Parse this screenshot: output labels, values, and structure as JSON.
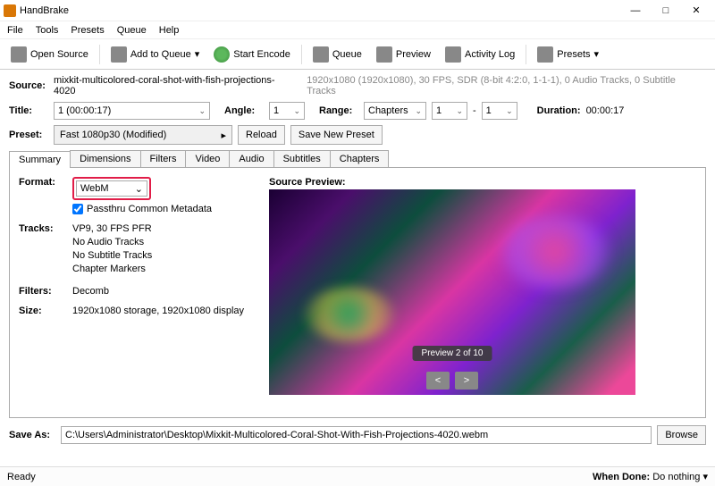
{
  "window": {
    "title": "HandBrake"
  },
  "menu": {
    "file": "File",
    "tools": "Tools",
    "presets": "Presets",
    "queue": "Queue",
    "help": "Help"
  },
  "toolbar": {
    "open_source": "Open Source",
    "add_queue": "Add to Queue",
    "start_encode": "Start Encode",
    "queue": "Queue",
    "preview": "Preview",
    "activity_log": "Activity Log",
    "presets": "Presets"
  },
  "source": {
    "label": "Source:",
    "name": "mixkit-multicolored-coral-shot-with-fish-projections-4020",
    "info": "1920x1080 (1920x1080), 30 FPS, SDR (8-bit 4:2:0, 1-1-1), 0 Audio Tracks, 0 Subtitle Tracks"
  },
  "title": {
    "label": "Title:",
    "value": "1  (00:00:17)"
  },
  "angle": {
    "label": "Angle:",
    "value": "1"
  },
  "range": {
    "label": "Range:",
    "value": "Chapters",
    "from": "1",
    "dash": "-",
    "to": "1"
  },
  "duration": {
    "label": "Duration:",
    "value": "00:00:17"
  },
  "preset": {
    "label": "Preset:",
    "value": "Fast 1080p30  (Modified)",
    "reload": "Reload",
    "save_new": "Save New Preset"
  },
  "tabs": {
    "summary": "Summary",
    "dimensions": "Dimensions",
    "filters": "Filters",
    "video": "Video",
    "audio": "Audio",
    "subtitles": "Subtitles",
    "chapters": "Chapters"
  },
  "summary": {
    "format_label": "Format:",
    "format_value": "WebM",
    "passthru": "Passthru Common Metadata",
    "tracks_label": "Tracks:",
    "tracks": [
      "VP9, 30 FPS PFR",
      "No Audio Tracks",
      "No Subtitle Tracks",
      "Chapter Markers"
    ],
    "filters_label": "Filters:",
    "filters_value": "Decomb",
    "size_label": "Size:",
    "size_value": "1920x1080 storage, 1920x1080 display",
    "preview_label": "Source Preview:",
    "preview_text": "Preview 2 of 10",
    "prev": "<",
    "next": ">"
  },
  "saveas": {
    "label": "Save As:",
    "value": "C:\\Users\\Administrator\\Desktop\\Mixkit-Multicolored-Coral-Shot-With-Fish-Projections-4020.webm",
    "browse": "Browse"
  },
  "status": {
    "ready": "Ready",
    "when_done_label": "When Done:",
    "when_done_value": "Do nothing"
  }
}
